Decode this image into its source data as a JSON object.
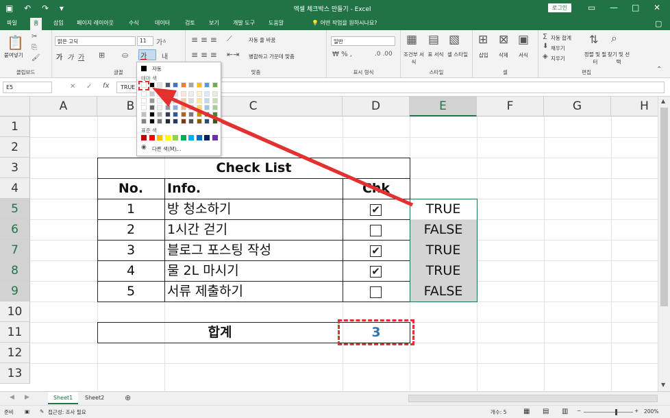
{
  "titlebar": {
    "title": "엑셀 체크박스 만들기 - Excel",
    "login": "로그인"
  },
  "tabs": [
    "파일",
    "홈",
    "삽입",
    "페이지 레이아웃",
    "수식",
    "데이터",
    "검토",
    "보기",
    "개발 도구",
    "도움말"
  ],
  "tab_search": "어떤 작업을 원하시나요?",
  "ribbon": {
    "paste": "붙여넣기",
    "clipboard": "클립보드",
    "font_name": "맑은 고딕",
    "font_size": "11",
    "font_group": "글꼴",
    "wrap": "자동 줄 바꿈",
    "merge": "병합하고 가운데 맞춤",
    "align_group": "맞춤",
    "num_format": "일반",
    "num_group": "표시 형식",
    "cond": "조건부 서식",
    "table": "표 서식",
    "cellstyle": "셀 스타일",
    "style_group": "스타일",
    "insert": "삽입",
    "delete": "삭제",
    "format": "서식",
    "cells_group": "셀",
    "autosum": "자동 합계",
    "fill": "채우기",
    "clear": "지우기",
    "sort": "정렬 및 필터",
    "find": "찾기 및 선택",
    "edit_group": "편집"
  },
  "palette": {
    "auto": "자동",
    "theme": "테마 색",
    "standard": "표준 색",
    "more": "다른 색(M)...",
    "theme_top": [
      "#ffffff",
      "#000000",
      "#e7e6e6",
      "#44546a",
      "#4472c4",
      "#ed7d31",
      "#a5a5a5",
      "#ffc000",
      "#5b9bd5",
      "#70ad47"
    ],
    "standard_colors": [
      "#c00000",
      "#ff0000",
      "#ffc000",
      "#ffff00",
      "#92d050",
      "#00b050",
      "#00b0f0",
      "#0070c0",
      "#002060",
      "#7030a0"
    ]
  },
  "formula": {
    "namebox": "E5",
    "value": "TRUE"
  },
  "columns": [
    "A",
    "B",
    "C",
    "D",
    "E",
    "F",
    "G",
    "H"
  ],
  "rows": [
    "1",
    "2",
    "3",
    "4",
    "5",
    "6",
    "7",
    "8",
    "9",
    "10",
    "11",
    "12",
    "13"
  ],
  "checklist": {
    "title": "Check List",
    "h_no": "No.",
    "h_info": "Info.",
    "h_chk": "Chk",
    "items": [
      {
        "no": "1",
        "info": "방 청소하기",
        "checked": true,
        "value": "TRUE"
      },
      {
        "no": "2",
        "info": "1시간 걷기",
        "checked": false,
        "value": "FALSE"
      },
      {
        "no": "3",
        "info": "블로그 포스팅 작성",
        "checked": true,
        "value": "TRUE"
      },
      {
        "no": "4",
        "info": "물 2L 마시기",
        "checked": true,
        "value": "TRUE"
      },
      {
        "no": "5",
        "info": "서류 제출하기",
        "checked": false,
        "value": "FALSE"
      }
    ],
    "total_label": "합계",
    "total_value": "3",
    "check_mark": "✔"
  },
  "sheets": [
    "Sheet1",
    "Sheet2"
  ],
  "status": {
    "ready": "준비",
    "access": "접근성: 조사 필요",
    "count": "개수: 5",
    "zoom": "200%"
  }
}
